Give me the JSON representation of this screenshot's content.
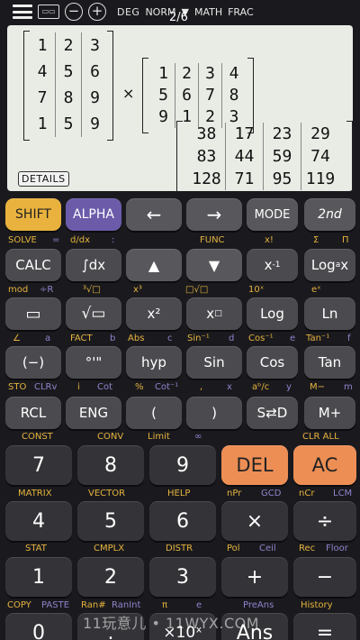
{
  "topbar": {
    "kbd": "▭▭",
    "minus": "−",
    "plus": "+",
    "deg": "DEG",
    "norm": "NORM",
    "norm_arrow": "▼",
    "math": "MATH",
    "frac": "FRAC",
    "page": "2/6"
  },
  "screen": {
    "matrix_a": [
      "1",
      "2",
      "3",
      "4",
      "5",
      "6",
      "7",
      "8",
      "9",
      "1",
      "5",
      "9"
    ],
    "times": "×",
    "matrix_b": [
      "1",
      "2",
      "3",
      "4",
      "5",
      "6",
      "7",
      "8",
      "9",
      "1",
      "2",
      "3"
    ],
    "result": [
      "38",
      "17",
      "23",
      "29",
      "83",
      "44",
      "59",
      "74",
      "128",
      "71",
      "95",
      "119"
    ],
    "details": "DETAILS"
  },
  "row1": {
    "shift": "SHIFT",
    "alpha": "ALPHA",
    "left": "←",
    "right": "→",
    "mode": "MODE",
    "second": "2nd"
  },
  "lab1": {
    "solve": "SOLVE",
    "eq": "=",
    "ddx": "d/dx",
    "colon": ":",
    "func": "FUNC",
    "xfact": "x!",
    "sum": "Σ",
    "prod": "Π"
  },
  "row2": {
    "calc": "CALC",
    "integral": "∫dx",
    "up": "▲",
    "down": "▼",
    "xinv": "x",
    "xinv_sup": "-1",
    "logax": "Log",
    "logax_sub": "a",
    "logax_x": "x"
  },
  "lab2": {
    "mod": "mod",
    "r": "÷R",
    "cbrt": "³√□",
    "x3": "x³",
    "nthroot": "□√□",
    "tenx": "10ˣ",
    "ex": "eˣ"
  },
  "row3": {
    "frac": "▭",
    "sqrt": "√▭",
    "x2": "x²",
    "xpow": "x",
    "xpow_sup": "□",
    "log": "Log",
    "ln": "Ln"
  },
  "lab3": {
    "angle": "∠",
    "a": "a",
    "fact": "FACT",
    "b": "b",
    "abs": "Abs",
    "c": "c",
    "asin": "Sin⁻¹",
    "d": "d",
    "acos": "Cos⁻¹",
    "e": "e",
    "atan": "Tan⁻¹",
    "f": "f"
  },
  "row4": {
    "neg": "(−)",
    "dms": "°'\"",
    "hyp": "hyp",
    "sin": "Sin",
    "cos": "Cos",
    "tan": "Tan"
  },
  "lab4": {
    "sto": "STO",
    "clrv": "CLRv",
    "i": "i",
    "cot": "Cot",
    "pct": "%",
    "acot": "Cot⁻¹",
    "comma": ",",
    "x": "x",
    "abc": "aᵇ/c",
    "y": "y",
    "mminus": "M−",
    "m": "m"
  },
  "row5": {
    "rcl": "RCL",
    "eng": "ENG",
    "lparen": "(",
    "rparen": ")",
    "sd": "S⇄D",
    "mplus": "M+"
  },
  "lab5": {
    "const": "CONST",
    "conv": "CONV",
    "limit": "Limit",
    "inf": "∞",
    "clrall": "CLR ALL"
  },
  "row6": {
    "k7": "7",
    "k8": "8",
    "k9": "9",
    "del": "DEL",
    "ac": "AC"
  },
  "lab6": {
    "matrix": "MATRIX",
    "vector": "VECTOR",
    "help": "HELP",
    "npr": "nPr",
    "gcd": "GCD",
    "ncr": "nCr",
    "lcm": "LCM"
  },
  "row7": {
    "k4": "4",
    "k5": "5",
    "k6": "6",
    "mul": "×",
    "div": "÷"
  },
  "lab7": {
    "stat": "STAT",
    "cmplx": "CMPLX",
    "distr": "DISTR",
    "pol": "Pol",
    "ceil": "Ceil",
    "rec": "Rec",
    "floor": "Floor"
  },
  "row8": {
    "k1": "1",
    "k2": "2",
    "k3": "3",
    "add": "+",
    "sub": "−"
  },
  "lab8": {
    "copy": "COPY",
    "paste": "PASTE",
    "ranh": "Ran#",
    "ranint": "RanInt",
    "pi": "π",
    "e": "e",
    "preans": "PreAns",
    "history": "History"
  },
  "row9": {
    "k0": "0",
    "dot": ".",
    "exp": "×10ˣ",
    "ans": "Ans",
    "eq": "="
  },
  "watermark": "11玩意儿 • 11WYX.COM"
}
